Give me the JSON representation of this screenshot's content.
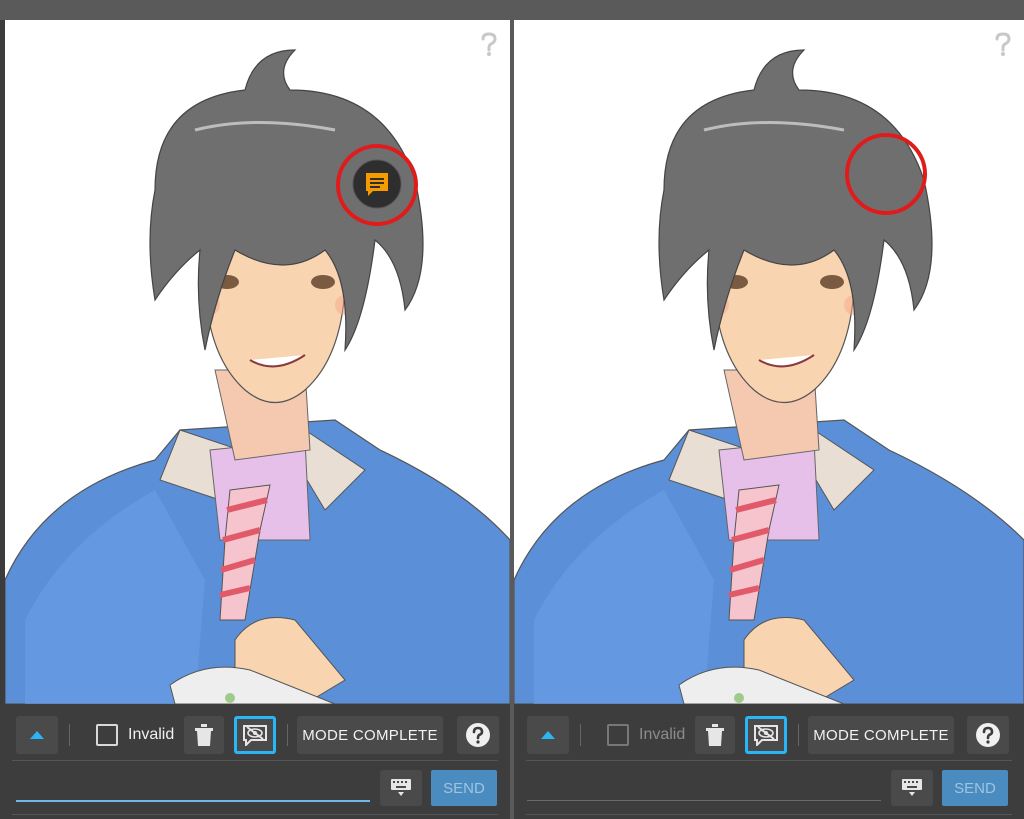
{
  "panels": [
    {
      "id": "left",
      "invalid_label": "Invalid",
      "mode_label": "MODE COMPLETE",
      "send_label": "SEND",
      "help_label": "?",
      "comment_marker_visible": true
    },
    {
      "id": "right",
      "invalid_label": "Invalid",
      "mode_label": "MODE COMPLETE",
      "send_label": "SEND",
      "help_label": "?",
      "comment_marker_visible": false
    }
  ],
  "icons": {
    "expand": "triangle-up-icon",
    "trash": "trash-icon",
    "hide_comments": "eye-off-comment-icon",
    "help": "help-circle-icon",
    "keyboard": "keyboard-icon",
    "comment_marker": "comment-bubble-icon",
    "corner_help": "question-mark-icon"
  },
  "colors": {
    "accent": "#29b6f6",
    "highlight_ring": "#e01b1b",
    "comment_marker": "#f59b00",
    "send": "#4a8cc0",
    "toolbar": "#3d3d3d"
  }
}
